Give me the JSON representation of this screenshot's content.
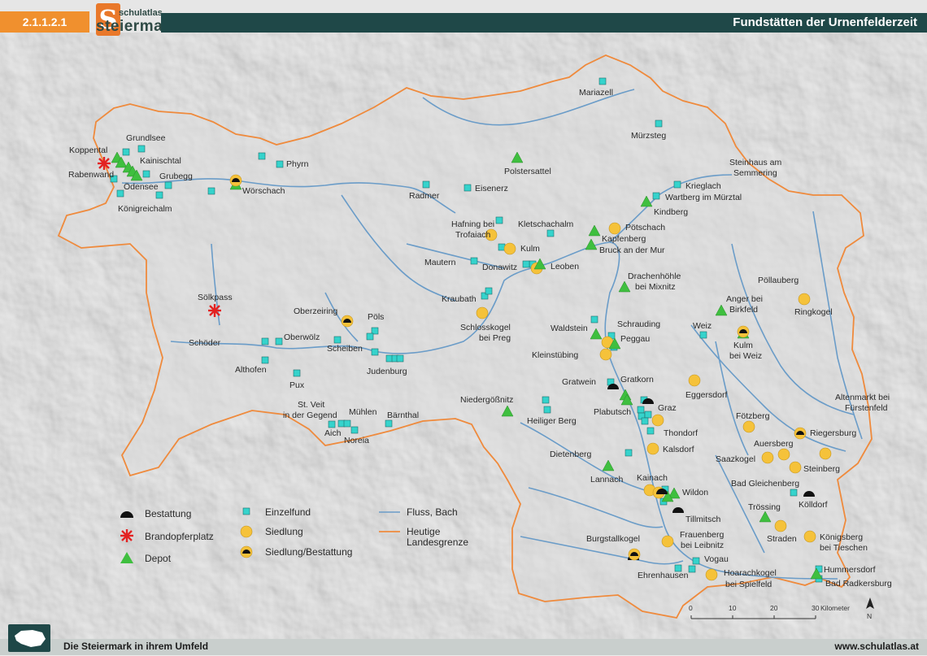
{
  "header": {
    "code": "2.1.1.2.1",
    "logo_small": "schulatlas",
    "logo_big": "steiermark",
    "logo_letter": "S",
    "title": "Fundstätten der Urnenfelderzeit"
  },
  "footer": {
    "left": "Die Steiermark in ihrem Umfeld",
    "right": "www.schulatlas.at"
  },
  "colors": {
    "einzelfund": "#35d3cc",
    "siedlung": "#f5c23a",
    "depot": "#3fbf3f",
    "brandopfer": "#e32222",
    "bestattung": "#111111",
    "border": "#ef8a3c",
    "river": "#6a9cc8"
  },
  "legend": {
    "bestattung": "Bestattung",
    "brandopfer": "Brandopferplatz",
    "depot": "Depot",
    "einzelfund": "Einzelfund",
    "siedlung": "Siedlung",
    "siedlung_bestattung": "Siedlung/Bestattung",
    "fluss": "Fluss, Bach",
    "grenze_line1": "Heutige",
    "grenze_line2": "Landesgrenze"
  },
  "scale": {
    "ticks": [
      "0",
      "10",
      "20",
      "30"
    ],
    "unit": "Kilometer",
    "north": "N"
  },
  "labels": {
    "grundlsee": "Grundlsee",
    "koppental": "Koppental",
    "kainischtal": "Kainischtal",
    "rabenwand": "Rabenwand",
    "grubegg": "Grubegg",
    "odensee": "Ödensee",
    "koenigreichalm": "Königreichalm",
    "phyrn": "Phyrn",
    "woerschach": "Wörschach",
    "mariazell": "Mariazell",
    "muerzsteg": "Mürzsteg",
    "polstersattel": "Polstersattel",
    "steinhaus1": "Steinhaus am",
    "steinhaus2": "Semmering",
    "krieglach": "Krieglach",
    "wartberg": "Wartberg im Mürztal",
    "kindberg": "Kindberg",
    "radmer": "Radmer",
    "eisenerz": "Eisenerz",
    "hafning1": "Hafning bei",
    "hafning2": "Trofaiach",
    "kletschachalm": "Kletschachalm",
    "poetschach": "Pötschach",
    "kapfenberg": "Kapfenberg",
    "bruck": "Bruck an der Mur",
    "kulm": "Kulm",
    "mautern": "Mautern",
    "donawitz": "Donawitz",
    "leoben": "Leoben",
    "drachenhoehle1": "Drachenhöhle",
    "drachenhoehle2": "bei Mixnitz",
    "poellauberg": "Pöllauberg",
    "ringkogel": "Ringkogel",
    "anger1": "Anger bei",
    "anger2": "Birkfeld",
    "soelkpass": "Sölkpass",
    "kraubath": "Kraubath",
    "schlosskogel1": "Schlosskogel",
    "schlosskogel2": "bei Preg",
    "oberzeiring": "Oberzeiring",
    "poels": "Pöls",
    "waldstein": "Waldstein",
    "schrauding": "Schrauding",
    "peggau": "Peggau",
    "weiz": "Weiz",
    "kulmweiz1": "Kulm",
    "kulmweiz2": "bei Weiz",
    "schoeder": "Schöder",
    "oberwoelz": "Oberwölz",
    "scheiben": "Scheiben",
    "kleinstuebing": "Kleinstübing",
    "althofen": "Althofen",
    "judenburg": "Judenburg",
    "pux": "Pux",
    "gratwein": "Gratwein",
    "gratkorn": "Gratkorn",
    "eggersdorf": "Eggersdorf",
    "altenmarkt1": "Altenmarkt bei",
    "altenmarkt2": "Fürstenfeld",
    "stveit1": "St. Veit",
    "stveit2": "in der Gegend",
    "muehlen": "Mühlen",
    "baernthal": "Bärnthal",
    "niedergoessnitz": "Niedergößnitz",
    "plabutsch": "Plabutsch",
    "graz": "Graz",
    "heiligerberg": "Heiliger Berg",
    "aich": "Aich",
    "noreia": "Noreia",
    "thondorf": "Thondorf",
    "foetzberg": "Fötzberg",
    "riegersburg": "Riegersburg",
    "dietenberg": "Dietenberg",
    "kalsdorf": "Kalsdorf",
    "auersberg": "Auersberg",
    "saazkogel": "Saazkogel",
    "steinberg": "Steinberg",
    "lannach": "Lannach",
    "kainach": "Kainach",
    "badgleichenberg": "Bad Gleichenberg",
    "wildon": "Wildon",
    "koelldorf": "Kölldorf",
    "troessing": "Trössing",
    "tillmitsch": "Tillmitsch",
    "straden": "Straden",
    "burgstallkogel": "Burgstallkogel",
    "frauenberg1": "Frauenberg",
    "frauenberg2": "bei Leibnitz",
    "koenigsberg1": "Königsberg",
    "koenigsberg2": "bei Tieschen",
    "vogau": "Vogau",
    "hummersdorf": "Hummersdorf",
    "ehrenhausen": "Ehrenhausen",
    "hoarachkogel1": "Hoarachkogel",
    "hoarachkogel2": "bei Spielfeld",
    "badradkersburg": "Bad Radkersburg"
  }
}
